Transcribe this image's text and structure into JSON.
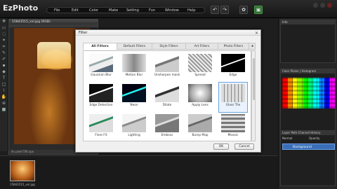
{
  "app": {
    "logo_main": "EzPhoto"
  },
  "menu": [
    "File",
    "Edit",
    "Color",
    "Make",
    "Setting",
    "Fun",
    "Window",
    "Help"
  ],
  "document": {
    "title": "15843515_xxl.jpg (RGB)",
    "status": "4x pixel 5fit.xpx"
  },
  "thumbnail": {
    "caption": "15843515_xxl.jpg"
  },
  "right_panels": {
    "top_title": "Info",
    "color_title_a": "Color Picker",
    "color_title_b": "Histogram",
    "layers_tabs": [
      "Layer",
      "Path",
      "Channel",
      "History"
    ],
    "blend_mode": "Normal",
    "opacity_label": "Opacity",
    "layer_name": "Background"
  },
  "dialog": {
    "title": "Filter",
    "tabs": [
      "All Filters",
      "Default Filters",
      "Style Filters",
      "Art Filters",
      "Photo Filters"
    ],
    "filters": [
      "Gaussian Blur",
      "Motion Blur",
      "Unsharpen mask",
      "Spread",
      "Edge",
      "Edge Detection",
      "Neon",
      "Dilate",
      "Apply Lens",
      "Glass Tile",
      "Flare FX",
      "Lighting",
      "Emboss",
      "Bump Map",
      "Mosaic"
    ],
    "selected": "Glass Tile",
    "ok": "OK",
    "cancel": "Cancel"
  }
}
